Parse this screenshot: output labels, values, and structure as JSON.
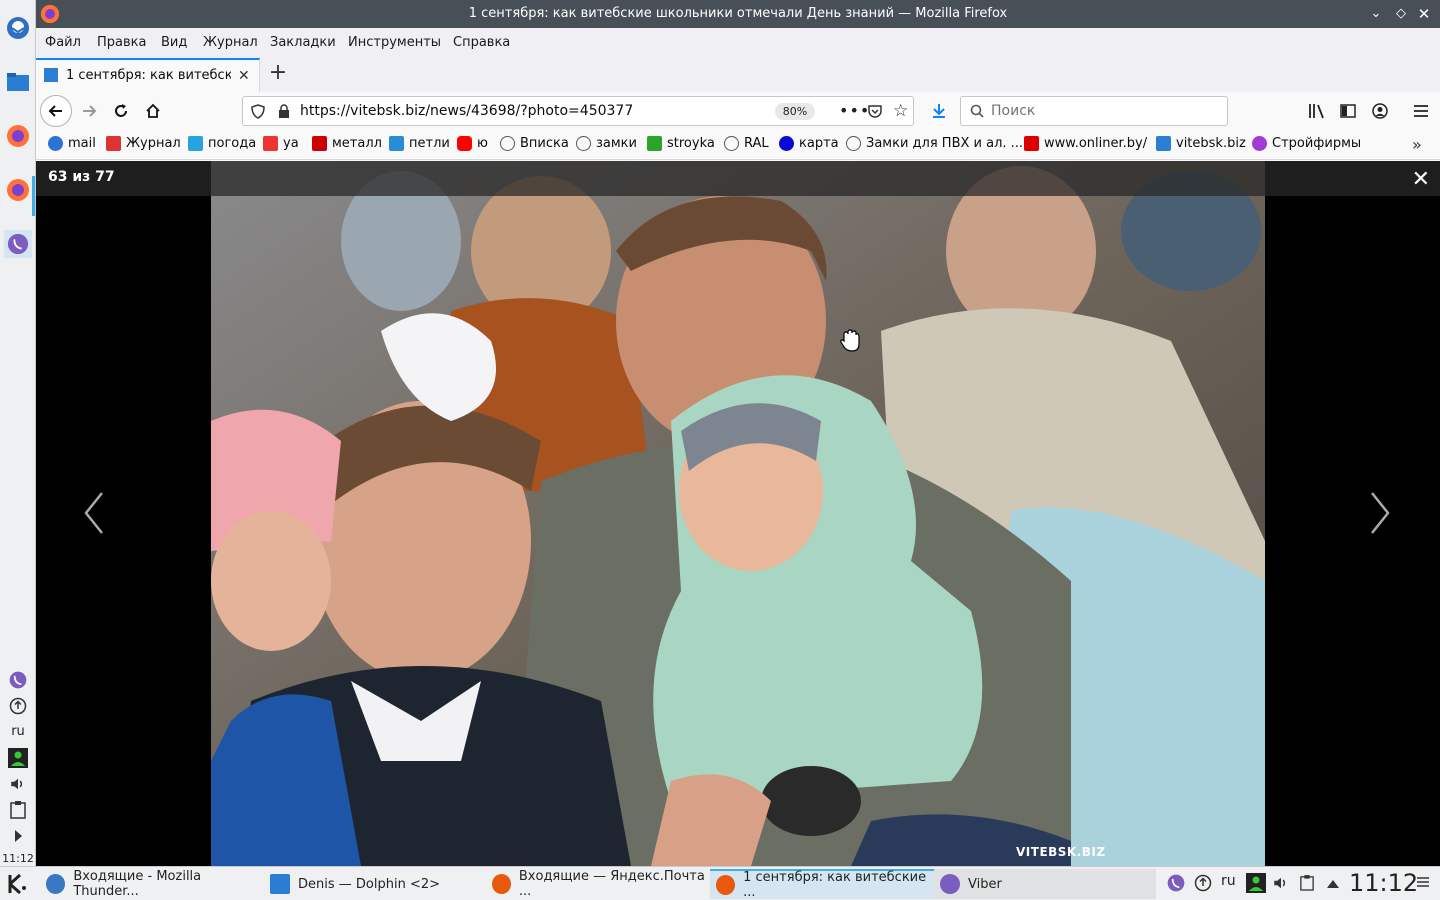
{
  "window": {
    "title": "1 сентября: как витебские школьники отмечали День знаний — Mozilla Firefox"
  },
  "menubar": {
    "items": [
      "Файл",
      "Правка",
      "Вид",
      "Журнал",
      "Закладки",
      "Инструменты",
      "Справка"
    ]
  },
  "tab": {
    "label": "1 сентября: как витебские школьники отмечали День знаний"
  },
  "navbar": {
    "url": "https://vitebsk.biz/news/43698/?photo=450377",
    "zoom": "80%",
    "search_placeholder": "Поиск"
  },
  "bookmarks": [
    {
      "label": "mail",
      "color": "#2a74d4"
    },
    {
      "label": "Журнал",
      "color": "#d33"
    },
    {
      "label": "погода",
      "color": "#29a3e0"
    },
    {
      "label": "уа",
      "color": "#e33"
    },
    {
      "label": "металл",
      "color": "#c00"
    },
    {
      "label": "петли",
      "color": "#2a8bd6"
    },
    {
      "label": "ю",
      "color": "#f00"
    },
    {
      "label": "Вписка",
      "color": "#555"
    },
    {
      "label": "замки",
      "color": "#555"
    },
    {
      "label": "stroyka",
      "color": "#2aa52a"
    },
    {
      "label": "RAL",
      "color": "#555"
    },
    {
      "label": "карта",
      "color": "#0a0ad4"
    },
    {
      "label": "Замки для ПВХ и ал. ...",
      "color": "#555"
    },
    {
      "label": "www.onliner.by/",
      "color": "#d00"
    },
    {
      "label": "vitebsk.biz",
      "color": "#2a7fd4"
    },
    {
      "label": "Стройфирмы",
      "color": "#a23ad4"
    }
  ],
  "lightbox": {
    "counter": "63 из 77",
    "watermark": "VITEBSK.BIZ"
  },
  "left_panel": {
    "lang": "ru",
    "time": "11:12"
  },
  "taskbar": {
    "tasks": [
      {
        "label": "Входящие - Mozilla Thunder...",
        "color": "#3b78c4"
      },
      {
        "label": "Denis — Dolphin <2>",
        "color": "#2b7cd3"
      },
      {
        "label": "Входящие — Яндекс.Почта ...",
        "color": "#e8590c"
      },
      {
        "label": "1 сентября: как витебские ...",
        "color": "#e8590c"
      },
      {
        "label": "Viber",
        "color": "#7b5cbf"
      }
    ],
    "lang": "ru",
    "clock": "11:12"
  }
}
